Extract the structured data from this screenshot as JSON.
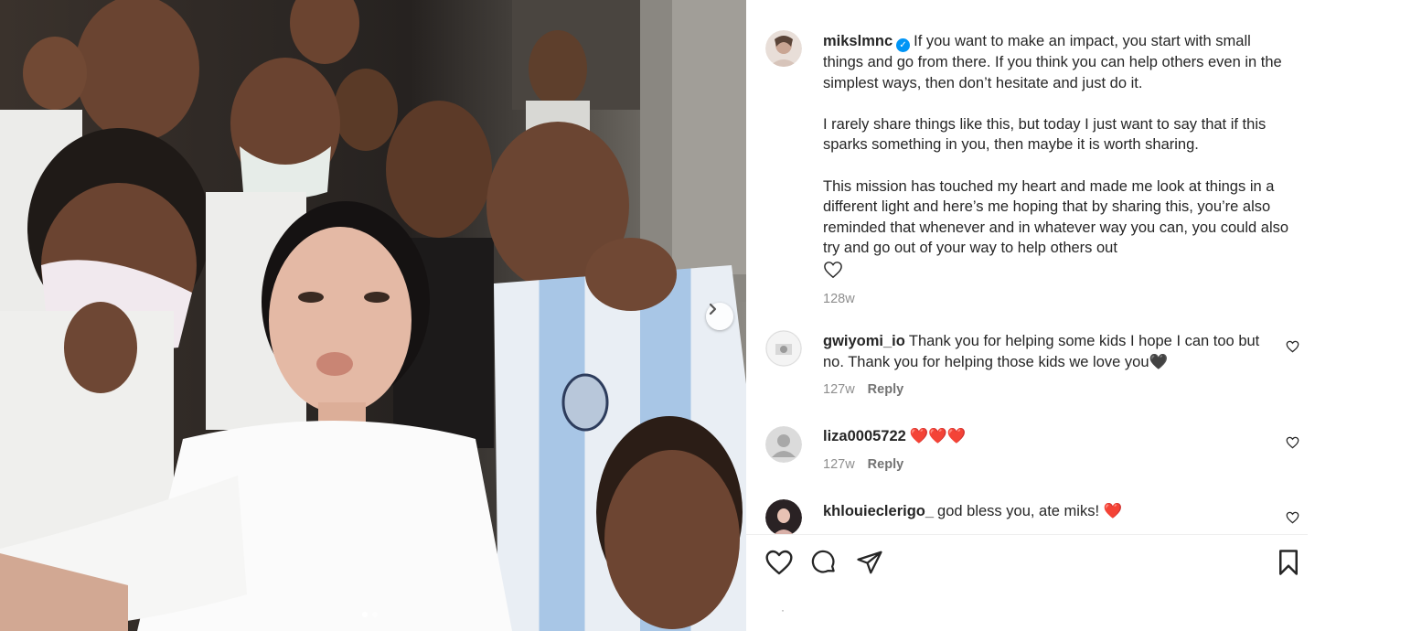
{
  "post": {
    "username": "mikslmnc",
    "verified_icon": "verified-badge-icon",
    "caption_paragraphs": [
      "If you want to make an impact, you start with small things and go from there. If you think you can help others even in the simplest ways, then don’t hesitate and just do it.",
      "I rarely share things like this, but today I just want to say that if this sparks something in you, then maybe it is worth sharing.",
      "This mission has touched my heart and made me look at things in a different light and here’s me hoping that by sharing this, you’re also reminded that whenever and in whatever way you can, you could also try and go out of your way to help others out"
    ],
    "caption_emoji_icon": "white-heart-icon",
    "timestamp": "128w"
  },
  "comments": [
    {
      "username": "gwiyomi_io",
      "text": "Thank you for helping some kids I hope I can too but no. Thank you for helping those kids we love you🖤",
      "time": "127w",
      "reply_label": "Reply"
    },
    {
      "username": "liza0005722",
      "text": "❤️❤️❤️",
      "time": "127w",
      "reply_label": "Reply"
    },
    {
      "username": "khlouieclerigo_",
      "text": "god bless you, ate miks! ❤️"
    }
  ],
  "actions": {
    "like_icon": "heart-icon",
    "comment_icon": "comment-icon",
    "share_icon": "share-icon",
    "save_icon": "bookmark-icon"
  },
  "carousel": {
    "next_icon": "chevron-right-icon",
    "total_slides": 2,
    "current_slide": 1
  },
  "footer_mark": "·",
  "colors": {
    "accent_blue": "#0095f6",
    "heart_red": "#e0143c",
    "muted_text": "#8e8e8e"
  }
}
